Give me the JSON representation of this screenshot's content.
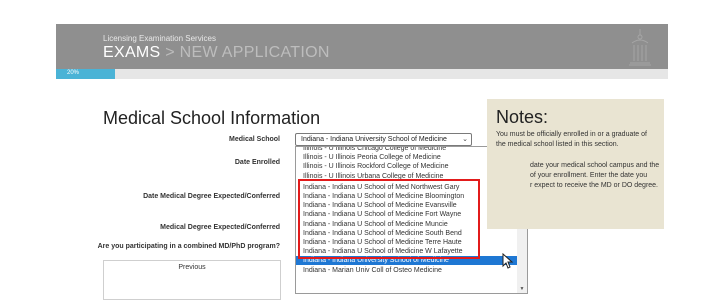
{
  "header": {
    "subtitle": "Licensing Examination Services",
    "title_main": "EXAMS",
    "title_sep": ">",
    "title_rest": "NEW APPLICATION"
  },
  "progress": {
    "percent_label": "20%",
    "fraction": 0.2
  },
  "section_title": "Medical School Information",
  "form": {
    "labels": {
      "medical_school": "Medical School",
      "date_enrolled": "Date Enrolled",
      "date_expected": "Date Medical Degree Expected/Conferred",
      "degree_expected": "Medical Degree Expected/Conferred",
      "combined_program": "Are you participating in a combined MD/PhD program?"
    },
    "medical_school_value": "Indiana - Indiana University School of Medicine"
  },
  "dropdown": {
    "options": [
      "Illinois - U Illinois Chicago College of Medicine",
      "Illinois - U Illinois Peoria College of Medicine",
      "Illinois - U Illinois Rockford College of Medicine",
      "Illinois - U Illinois Urbana College of Medicine",
      "Indiana - Indiana U School of Med Northwest Gary",
      "Indiana - Indiana U School of Medicine Bloomington",
      "Indiana - Indiana U School of Medicine Evansville",
      "Indiana - Indiana U School of Medicine Fort Wayne",
      "Indiana - Indiana U School of Medicine Muncie",
      "Indiana - Indiana U School of Medicine South Bend",
      "Indiana - Indiana U School of Medicine Terre Haute",
      "Indiana - Indiana U School of Medicine W Lafayette",
      "Indiana - Indiana University School of Medicine",
      "Indiana - Marian Univ Coll of Osteo Medicine"
    ],
    "selected_index": 12
  },
  "notes": {
    "title": "Notes:",
    "lines": [
      "You must be officially enrolled in or a graduate of",
      "the medical school listed in this section.",
      "date your medical school campus and the",
      "of your enrollment. Enter the date you",
      "r expect to receive the MD or DO degree."
    ]
  },
  "previous_button": "Previous",
  "colors": {
    "banner_bg": "#8f8f8f",
    "progress_fill": "#4ab3d6",
    "selected_option": "#1e77d3",
    "highlight_box": "#e21b1b",
    "notes_bg": "#e9e4d2"
  },
  "icons": [
    "seal-icon",
    "chevron-down-icon",
    "scroll-up-icon",
    "scroll-down-icon",
    "mouse-cursor-icon"
  ]
}
